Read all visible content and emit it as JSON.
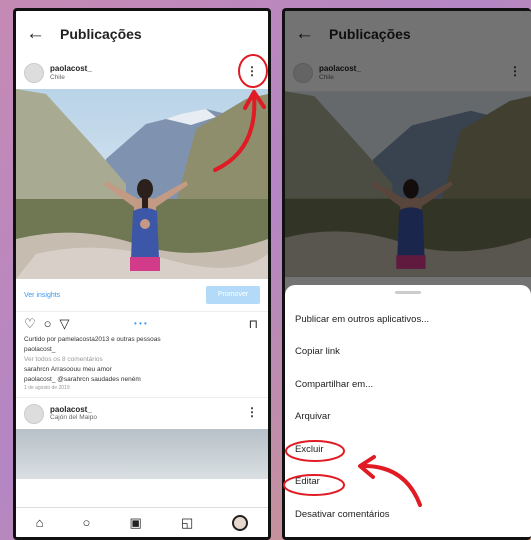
{
  "screen_title": "Publicações",
  "post": {
    "username": "paolacost_",
    "location": "Chile"
  },
  "insights": {
    "link": "Ver insights",
    "promote": "Promover"
  },
  "meta": {
    "liked": "Curtido por pamelacosta2013 e outras pessoas",
    "caption_user": "paolacost_",
    "view_comments": "Ver todos os 8 comentários",
    "comment1": "sarahrcn Arrasoouu meu amor",
    "comment2": "paolacost_ @sarahrcn saudades neném",
    "date": "1 de agosto de 2019"
  },
  "post2": {
    "username": "paolacost_",
    "location": "Cajón del Maipo"
  },
  "menu": {
    "items": [
      "Publicar em outros aplicativos...",
      "Copiar link",
      "Compartilhar em...",
      "Arquivar",
      "Excluir",
      "Editar",
      "Desativar comentários"
    ]
  },
  "icons": {
    "back": "arrow-left",
    "more": "three-dots-vertical",
    "like": "heart",
    "comment": "speech-bubble",
    "share": "paper-plane",
    "save": "bookmark",
    "nav": [
      "home",
      "search",
      "reels",
      "shop",
      "profile"
    ]
  },
  "colors": {
    "annotation": "#e01b24",
    "link": "#3897f0"
  }
}
